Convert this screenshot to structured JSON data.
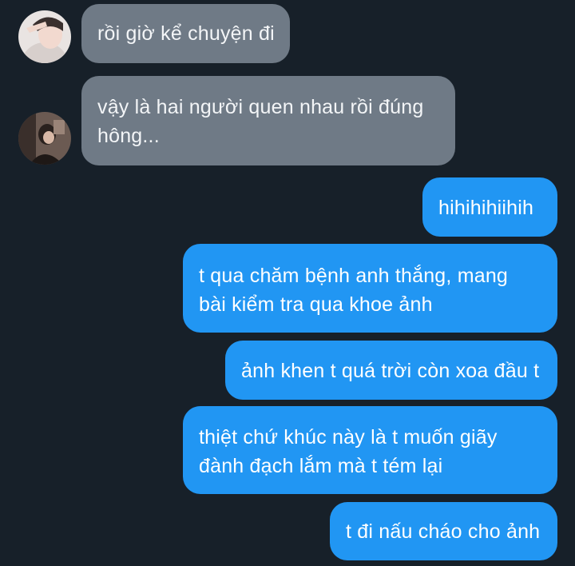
{
  "messages": [
    {
      "direction": "incoming",
      "avatar": "avatar-1",
      "lines": [
        "rồi giờ kể chuyện đi"
      ]
    },
    {
      "direction": "incoming",
      "avatar": "avatar-2",
      "lines": [
        "vậy là hai người quen nhau rồi đúng",
        "hông..."
      ]
    },
    {
      "direction": "outgoing",
      "lines": [
        "hihihihiihih"
      ]
    },
    {
      "direction": "outgoing",
      "lines": [
        "t qua chăm bệnh anh thắng, mang",
        "bài kiểm tra qua khoe ảnh"
      ]
    },
    {
      "direction": "outgoing",
      "lines": [
        "ảnh khen t quá trời còn xoa đầu t"
      ]
    },
    {
      "direction": "outgoing",
      "lines": [
        "thiệt chứ khúc này là t muốn giãy",
        "đành đạch lắm mà t tém lại"
      ]
    },
    {
      "direction": "outgoing",
      "lines": [
        "t đi nấu cháo cho ảnh"
      ]
    }
  ],
  "colors": {
    "background": "#172029",
    "incoming_bubble": "#6f7a86",
    "outgoing_bubble": "#2196f3"
  }
}
